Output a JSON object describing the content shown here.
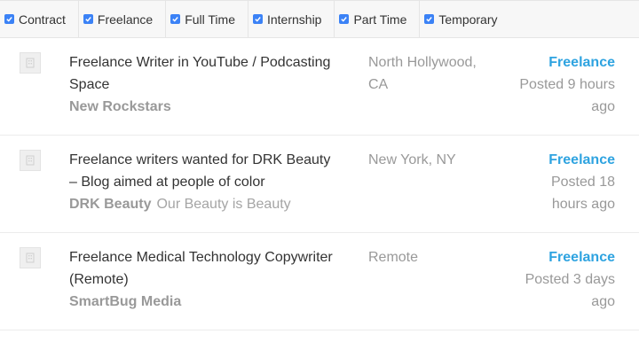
{
  "filters": [
    {
      "label": "Contract",
      "checked": true
    },
    {
      "label": "Freelance",
      "checked": true
    },
    {
      "label": "Full Time",
      "checked": true
    },
    {
      "label": "Internship",
      "checked": true
    },
    {
      "label": "Part Time",
      "checked": true
    },
    {
      "label": "Temporary",
      "checked": true
    }
  ],
  "jobs": [
    {
      "title_line1": "Freelance Writer in YouTube / Podcasting",
      "title_line2": "Space",
      "company": "New Rockstars",
      "tagline": "",
      "location_line1": "North Hollywood,",
      "location_line2": "CA",
      "type": "Freelance",
      "date_line1": "Posted 9 hours",
      "date_line2": "ago"
    },
    {
      "title_line1": "Freelance writers wanted for DRK Beauty",
      "title_line2": "– Blog aimed at people of color",
      "company": "DRK Beauty",
      "tagline": "Our Beauty is Beauty",
      "location_line1": "New York, NY",
      "location_line2": "",
      "type": "Freelance",
      "date_line1": "Posted 18",
      "date_line2": "hours ago"
    },
    {
      "title_line1": "Freelance Medical Technology Copywriter",
      "title_line2": "(Remote)",
      "company": "SmartBug Media",
      "tagline": "",
      "location_line1": "Remote",
      "location_line2": "",
      "type": "Freelance",
      "date_line1": "Posted 3 days",
      "date_line2": "ago"
    }
  ],
  "colors": {
    "checkbox": "#3b82f6",
    "job_type": "#2ea3e0",
    "muted": "#999999"
  },
  "icons": {
    "checkbox": "checkbox-checked-icon",
    "company_logo": "building-placeholder-icon"
  }
}
